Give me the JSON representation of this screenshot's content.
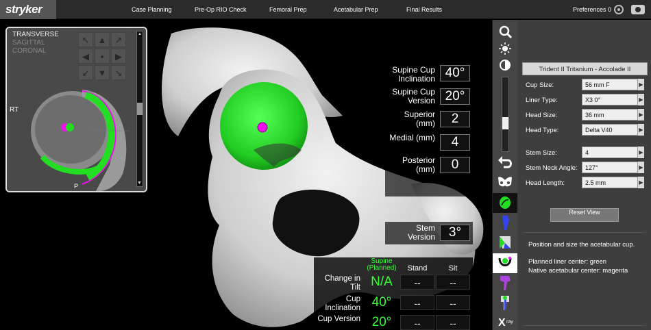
{
  "brand": "stryker",
  "nav": {
    "tabs": [
      "Case Planning",
      "Pre-Op RIO Check",
      "Femoral Prep",
      "Acetabular Prep",
      "Final Results"
    ],
    "preferences": "Preferences 0"
  },
  "ct_view": {
    "labels": [
      "TRANSVERSE",
      "SAGITTAL",
      "CORONAL"
    ],
    "side_label": "RT",
    "posterior_label": "P"
  },
  "overlay": {
    "rows": [
      {
        "label": "Supine Cup Inclination",
        "value": "40°"
      },
      {
        "label": "Supine Cup Version",
        "value": "20°"
      },
      {
        "label": "Superior (mm)",
        "value": "2"
      },
      {
        "label": "Medial (mm)",
        "value": "4"
      },
      {
        "label": "Posterior (mm)",
        "value": "0"
      }
    ],
    "stem_version": {
      "label": "Stem Version",
      "value": "3°"
    }
  },
  "table": {
    "headers": [
      "Supine (Planned)",
      "Stand",
      "Sit"
    ],
    "rows": [
      {
        "label": "Change in Tilt",
        "values": [
          "N/A",
          "--",
          "--"
        ]
      },
      {
        "label": "Cup Inclination",
        "values": [
          "40°",
          "--",
          "--"
        ]
      },
      {
        "label": "Cup Version",
        "values": [
          "20°",
          "--",
          "--"
        ]
      }
    ]
  },
  "panel": {
    "implant": "Trident II Tritanium - Accolade II",
    "fields_a": [
      {
        "label": "Cup Size:",
        "value": "56 mm F"
      },
      {
        "label": "Liner Type:",
        "value": "X3 0°"
      },
      {
        "label": "Head Size:",
        "value": "36 mm"
      },
      {
        "label": "Head Type:",
        "value": "Delta V40"
      }
    ],
    "fields_b": [
      {
        "label": "Stem Size:",
        "value": "4"
      },
      {
        "label": "Stem Neck Angle:",
        "value": "127°"
      },
      {
        "label": "Head Length:",
        "value": "2.5 mm"
      }
    ],
    "reset": "Reset View",
    "instruction": "Position and size the acetabular cup.",
    "legend_green": "Planned liner center: green",
    "legend_magenta": "Native acetabular center: magenta"
  },
  "colors": {
    "green": "#22dd22",
    "magenta": "#ee11ee",
    "topbar": "#2b2b2b",
    "panel": "#3e3e3e"
  },
  "icons": [
    "search-icon",
    "brightness-icon",
    "contrast-icon",
    "undo-icon",
    "pelvis-icon",
    "cup-icon",
    "stem-icon",
    "femur-head-icon",
    "cup-impaction-icon",
    "femur-icon",
    "stem-implant-icon",
    "xray-icon"
  ]
}
